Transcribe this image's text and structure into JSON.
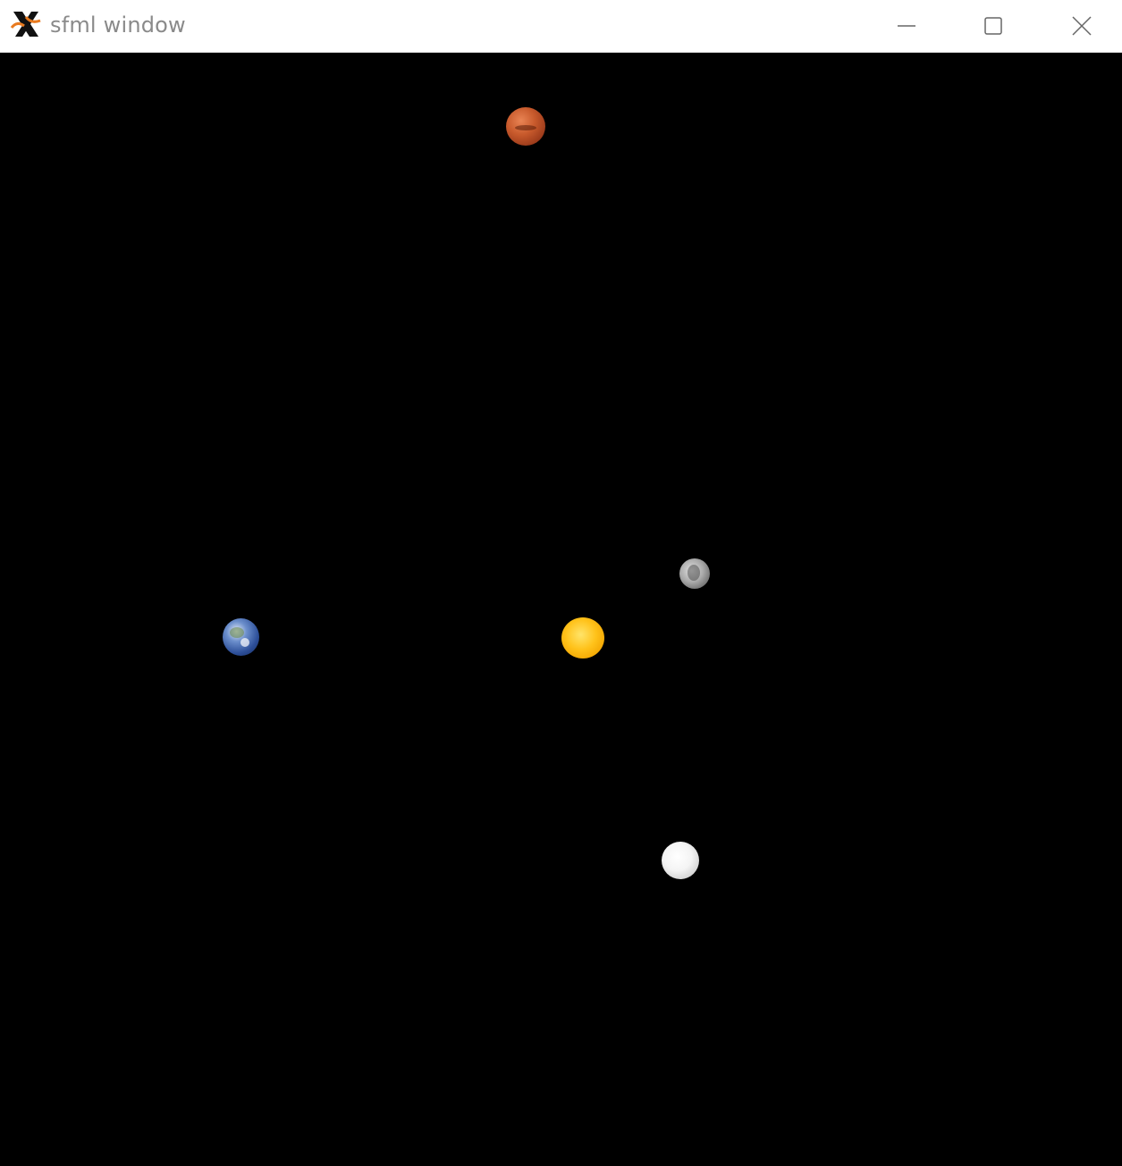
{
  "window": {
    "title": "sfml window",
    "controls": {
      "minimize_icon": "minimize-icon",
      "maximize_icon": "maximize-icon",
      "close_icon": "close-icon"
    }
  },
  "scene": {
    "background": "#000000",
    "bodies": [
      {
        "name": "mars",
        "color": "#c85a2c"
      },
      {
        "name": "moon",
        "color": "#a9a9a9"
      },
      {
        "name": "sun",
        "color": "#ffc21a"
      },
      {
        "name": "earth",
        "color": "#2d4f99"
      },
      {
        "name": "white-planet",
        "color": "#f4f4f4"
      }
    ]
  }
}
